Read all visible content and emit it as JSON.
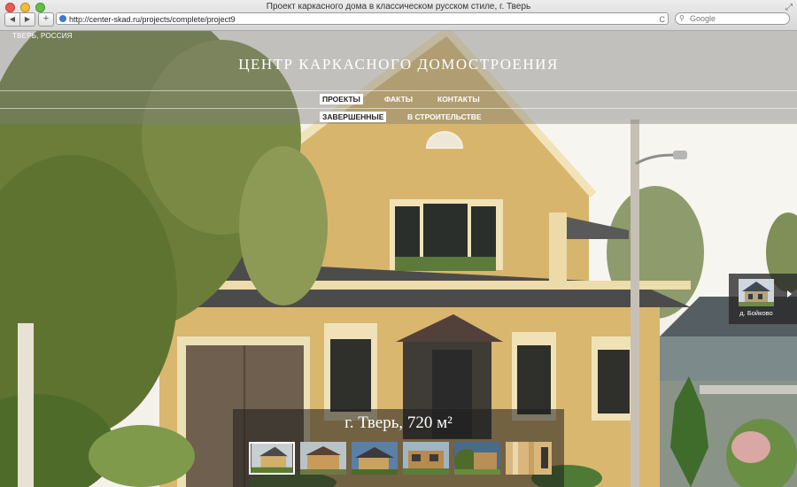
{
  "browser": {
    "window_title": "Проект каркасного дома в классическом русском стиле, г. Тверь",
    "url": "http://center-skad.ru/projects/complete/project9",
    "search_placeholder": "Google",
    "add_tab_label": "+",
    "back_label": "◀",
    "forward_label": "▶",
    "reload_label": "C"
  },
  "site": {
    "location": "ТВЕРЬ, РОССИЯ",
    "title": "ЦЕНТР КАРКАСНОГО ДОМОСТРОЕНИЯ",
    "menu": {
      "projects": "ПРОЕКТЫ",
      "facts": "ФАКТЫ",
      "contacts": "КОНТАКТЫ"
    },
    "submenu": {
      "completed": "ЗАВЕРШЕННЫЕ",
      "in_progress": "В СТРОИТЕЛЬСТВЕ"
    }
  },
  "project": {
    "caption": "г. Тверь, 720 м²",
    "thumbnails": 6,
    "active_thumbnail": 1
  },
  "next_project": {
    "label": "д. Бойково"
  },
  "colors": {
    "house_wall": "#d9b76f",
    "house_trim": "#f1e3b9",
    "roof": "#4c4b4b",
    "sky": "#f4f1ea",
    "foliage": "#6c7d3a",
    "overlay": "#7d7d7d"
  }
}
